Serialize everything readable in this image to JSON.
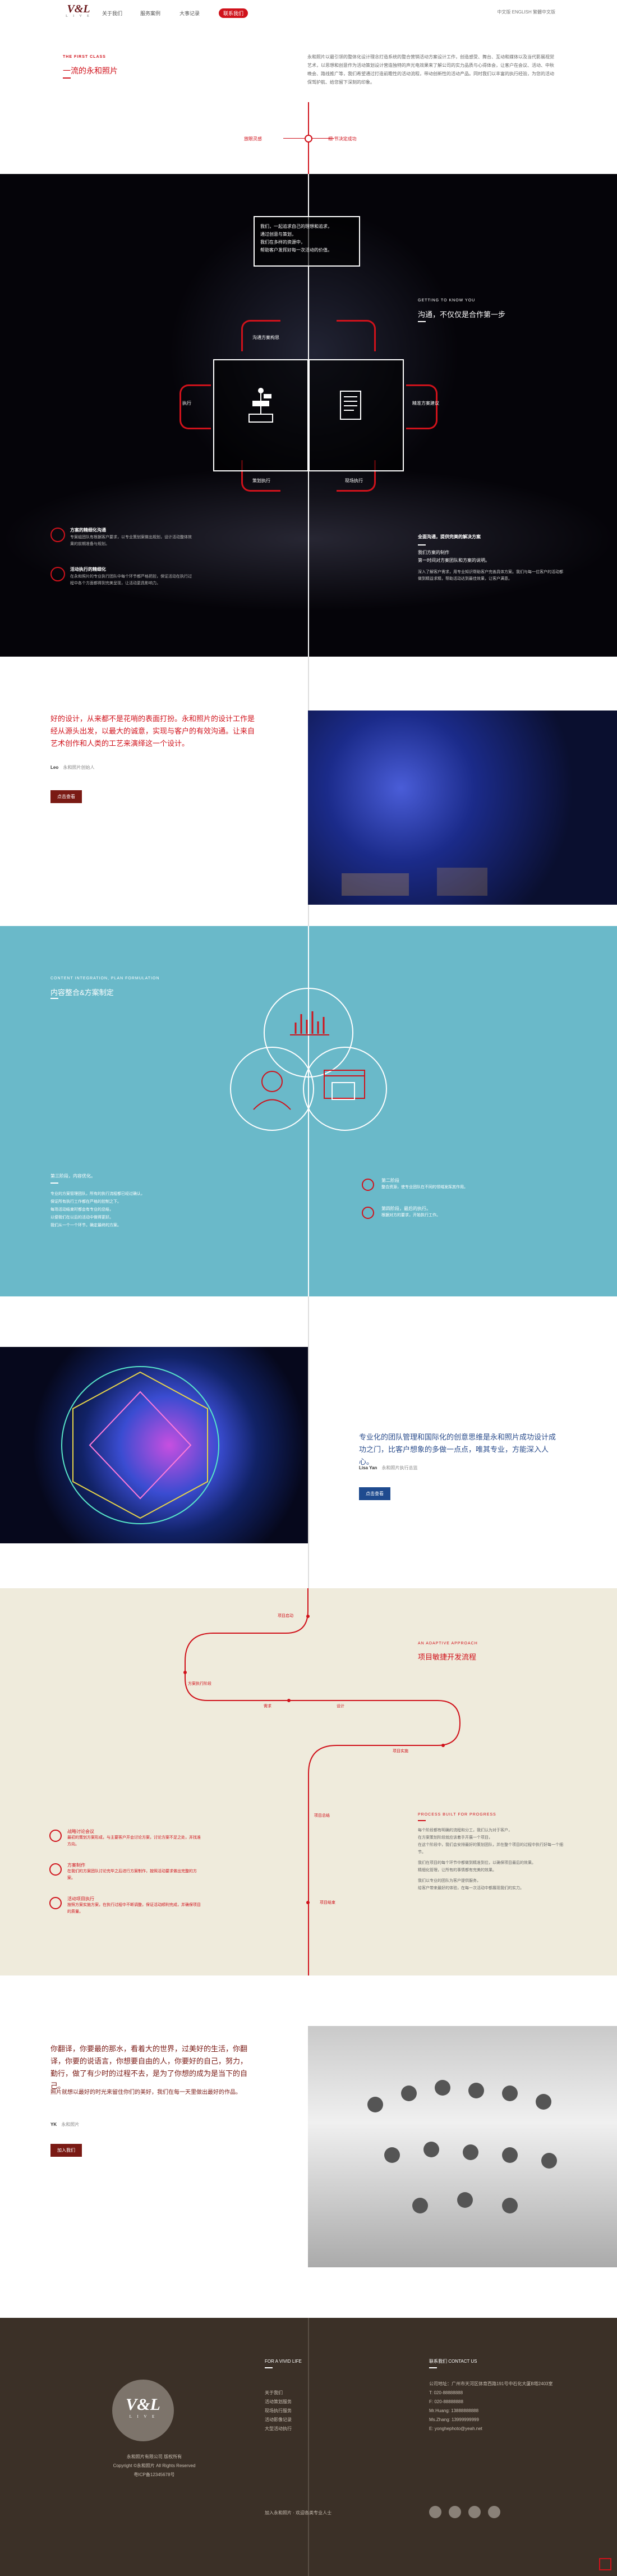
{
  "header": {
    "logo_text": "V&L",
    "logo_sub": "L I V E",
    "nav": [
      "关于我们",
      "服务案例",
      "大事记录",
      "联系我们"
    ],
    "right_text": "中文版 ENGLISH 繁體中文版"
  },
  "intro": {
    "eyebrow": "THE FIRST CLASS",
    "title": "一流的永和照片",
    "paragraph": "永和照片以最引领的整体化设计理念打造系统的整合营销活动方案设计工作，创造感受、舞台、互动和媒体以及当代影展视觉艺术，以思想和创意作为活动策划设计营造独特的声光电效果来了解公司的实力品质与心得体会，让客户在会议、活动、中秋晚会、路线推广等，我们希望通过打造前瞻性的活动流程，带动创新性的活动产品。同时我们以丰富的执行经验，为您的活动保驾护航、给您留下深刻的印象。",
    "left_pill": "放眼灵感",
    "right_pill": "细·节决定成功"
  },
  "dark": {
    "box_text": [
      "我们，一起追求自己的理想和追求，",
      "通过创意与策划，",
      "我们在多样的资源中，",
      "帮助客户发挥好每一次活动的价值。"
    ],
    "eyebrow": "GETTING TO KNOW YOU",
    "title": "沟通，不仅仅是合作第一步",
    "nodes": {
      "top": "沟通方案构思",
      "left": "执行",
      "bottom_left": "策划执行",
      "bottom_right": "现场执行",
      "right": "精准方案建议"
    },
    "left_items": [
      {
        "title": "方案的精细化沟通",
        "text": "专案组团队有根据客户要求，以专业策划案做出规划，设计活动整体效果的前期准备与规划。"
      },
      {
        "title": "活动执行的精细化",
        "text": "在永和照片的专业执行团队中每个环节都严格把控，保证活动在执行过程中各个方面都得到完美呈现，让活动更具影响力。"
      }
    ],
    "right_block": {
      "title": "全面沟通，提供完美的解决方案",
      "items": [
        "我们方案的制作",
        "第一时间对方案团队和方案的说明。"
      ],
      "note": "深入了解客户需求，用专业知识帮助客户完善具体方案。我们与每一位客户的活动都做到精益求精，帮助活动达到最佳效果，让客户满意。"
    }
  },
  "quote1": {
    "text": "好的设计，从来都不是花哨的表面打扮。永和照片的设计工作是经从源头出发，以最大的诚意，实现与客户的有效沟通。让来自艺术创作和人类的工艺来演绎这一个设计。",
    "author": "Leo",
    "role": "永和照片创始人",
    "button": "点击查看"
  },
  "blue": {
    "eyebrow": "CONTENT INTEGRATION, PLAN FORMULATION",
    "title": "内容整合&方案制定",
    "left_title": "第三阶段，内容优化。",
    "left_lines": [
      "专业的方案管理团队，所有的执行流程都已经过确认，",
      "保证所有执行工作都在严格的控制之下。",
      "每场活动结束时都会有专业的总结，",
      "以便我们在以后的活动中做得更好。",
      "我们从一个一个环节，确定最终的方案。"
    ],
    "right_items": [
      {
        "title": "第二阶段",
        "text": "整合资源，使专业团队在不同的领域发挥其作用。"
      },
      {
        "title": "第四阶段，最后的执行。",
        "text": "根据对方的要求，开始执行工作。"
      }
    ]
  },
  "quote2": {
    "text": "专业化的团队管理和国际化的创意思维是永和照片成功设计成功之门，比客户想象的多做一点点，唯其专业，方能深入人心。",
    "author": "Lisa Yan",
    "role": "永和照片执行总监",
    "button": "点击查看"
  },
  "beige": {
    "eyebrow": "AN ADAPTIVE APPROACH",
    "title": "项目敏捷开发流程",
    "path_labels": [
      "项目启动",
      "方案执行阶段",
      "需求",
      "设计",
      "项目实施",
      "项目总结",
      "项目结束"
    ],
    "left_items": [
      {
        "title": "战略讨论会议",
        "text": "最初的策划方案形成，与主要客户开会讨论方案，讨论方案不足之处，并找准方向。"
      },
      {
        "title": "方案制作",
        "text": "在我们的方案团队讨论完毕之后进行方案制作，按照活动要求做出完整的方案。"
      },
      {
        "title": "活动项目执行",
        "text": "按照方案实施方案，在执行过程中不断调整，保证活动顺利完成，并确保项目的质量。"
      }
    ],
    "right_eyebrow": "PROCESS BUILT FOR PROGRESS",
    "right_lines": [
      "每个阶段都有明确的流程和分工，我们认为对于客户，",
      "在方案策划阶段就应该着手开展一个项目，",
      "在这个阶段中，我们会安排最好的策划团队，并在整个项目的过程中执行好每一个细节。",
      "我们在项目的每个环节中都做到精准到位，以确保项目最后的效果。",
      "精细化管理，让所有的事情都有完美的效果。",
      "我们以专业的团队为客户提供服务，",
      "给客户带来最好的体验，在每一次活动中都展现我们的实力。"
    ]
  },
  "quote3": {
    "text": "你翻译，你要最的那水，看着大的世界，过美好的生活，你翻译，你要的说语言，你想要自由的人，你要好的自己，努力，勤行，做了有少时的过程不去，是为了你想的成为是当下的自己。",
    "text2": "照片就想以最好的时光来留住你们的美好，我们在每一天里做出最好的作品。",
    "author": "YK",
    "role": "永和照片",
    "button": "加入我们"
  },
  "footer": {
    "logo_text": "V&L",
    "logo_sub": "L I V E",
    "left_lines": [
      "永和照片有限公司 版权所有",
      "Copyright ©永和照片 All Rights Reserved",
      "粤ICP备12345678号"
    ],
    "mid_title": "FOR A VIVID LIFE",
    "mid_links": [
      "关于我们",
      "",
      "活动策划服务",
      "现场执行服务",
      "活动影像记录",
      "大型活动执行"
    ],
    "mid_bottom": "加入永和照片 · 欢迎各类专业人士",
    "right_title": "联系我们 CONTACT US",
    "right_lines": [
      "公司地址：广州市天河区体育西路191号中石化大厦B塔2403室",
      "T: 020-88888888",
      "F: 020-88888888",
      "Mr.Huang: 13888888888",
      "Ms.Zhang: 13999999999",
      "E: yonghephoto@yeah.net"
    ],
    "icons": [
      "weibo-icon",
      "wechat-icon",
      "qq-icon",
      "mail-icon"
    ]
  }
}
